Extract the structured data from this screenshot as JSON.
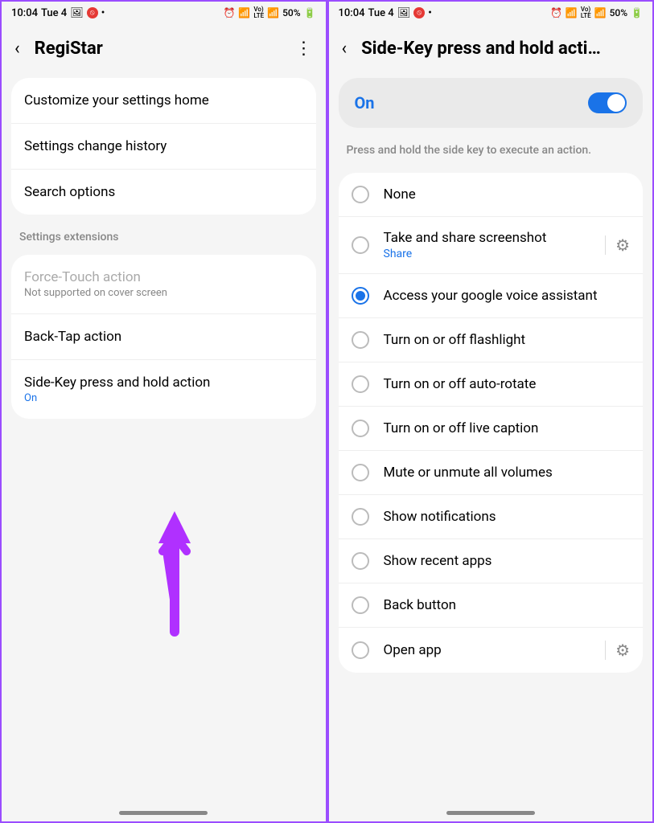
{
  "status": {
    "time": "10:04",
    "date": "Tue 4",
    "battery": "50%",
    "lte_label": "Vo) LTE"
  },
  "left": {
    "title": "RegiStar",
    "items": [
      {
        "title": "Customize your settings home"
      },
      {
        "title": "Settings change history"
      },
      {
        "title": "Search options"
      }
    ],
    "section_header": "Settings extensions",
    "extensions": [
      {
        "title": "Force-Touch action",
        "subtitle": "Not supported on cover screen",
        "disabled": true
      },
      {
        "title": "Back-Tap action"
      },
      {
        "title": "Side-Key press and hold action",
        "status": "On"
      }
    ]
  },
  "right": {
    "title": "Side-Key press and hold acti…",
    "toggle_label": "On",
    "description": "Press and hold the side key to execute an action.",
    "options": [
      {
        "title": "None",
        "selected": false
      },
      {
        "title": "Take and share screenshot",
        "subtitle": "Share",
        "selected": false,
        "gear": true
      },
      {
        "title": "Access your google voice assistant",
        "selected": true
      },
      {
        "title": "Turn on or off flashlight",
        "selected": false
      },
      {
        "title": "Turn on or off auto-rotate",
        "selected": false
      },
      {
        "title": "Turn on or off live caption",
        "selected": false
      },
      {
        "title": "Mute or unmute all volumes",
        "selected": false
      },
      {
        "title": "Show notifications",
        "selected": false
      },
      {
        "title": "Show recent apps",
        "selected": false
      },
      {
        "title": "Back button",
        "selected": false
      },
      {
        "title": "Open app",
        "selected": false,
        "gear": true
      }
    ]
  }
}
